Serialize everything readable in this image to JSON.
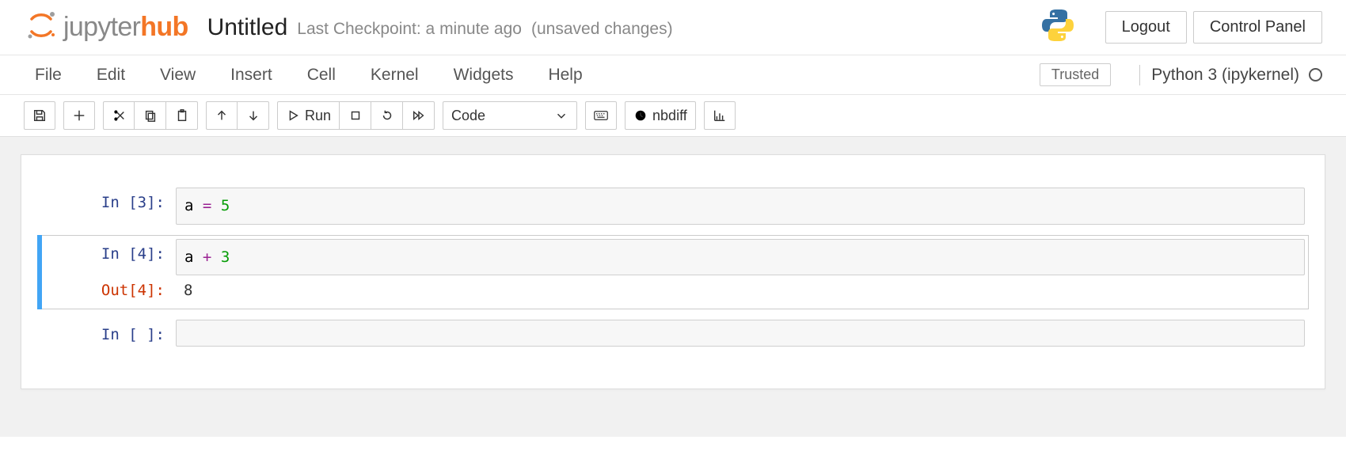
{
  "header": {
    "logo_text_gray": "jupyter",
    "logo_text_orange": "hub",
    "doc_title": "Untitled",
    "checkpoint_text": "Last Checkpoint: a minute ago",
    "unsaved_text": "(unsaved changes)",
    "logout_label": "Logout",
    "control_panel_label": "Control Panel"
  },
  "menubar": {
    "items": [
      "File",
      "Edit",
      "View",
      "Insert",
      "Cell",
      "Kernel",
      "Widgets",
      "Help"
    ],
    "trusted_label": "Trusted",
    "kernel_name": "Python 3 (ipykernel)"
  },
  "toolbar": {
    "run_label": "Run",
    "cell_type_selected": "Code",
    "nbdiff_label": "nbdiff"
  },
  "cells": [
    {
      "type": "code",
      "in_prompt": "In [3]:",
      "tokens": [
        {
          "t": "a",
          "cls": "tok-var"
        },
        {
          "t": " ",
          "cls": ""
        },
        {
          "t": "=",
          "cls": "tok-op"
        },
        {
          "t": " ",
          "cls": ""
        },
        {
          "t": "5",
          "cls": "tok-num"
        }
      ],
      "selected": false
    },
    {
      "type": "code",
      "in_prompt": "In [4]:",
      "tokens": [
        {
          "t": "a",
          "cls": "tok-var"
        },
        {
          "t": " ",
          "cls": ""
        },
        {
          "t": "+",
          "cls": "tok-op"
        },
        {
          "t": " ",
          "cls": ""
        },
        {
          "t": "3",
          "cls": "tok-num"
        }
      ],
      "out_prompt": "Out[4]:",
      "output": "8",
      "selected": true
    },
    {
      "type": "code",
      "in_prompt": "In [ ]:",
      "tokens": [],
      "selected": false
    }
  ]
}
